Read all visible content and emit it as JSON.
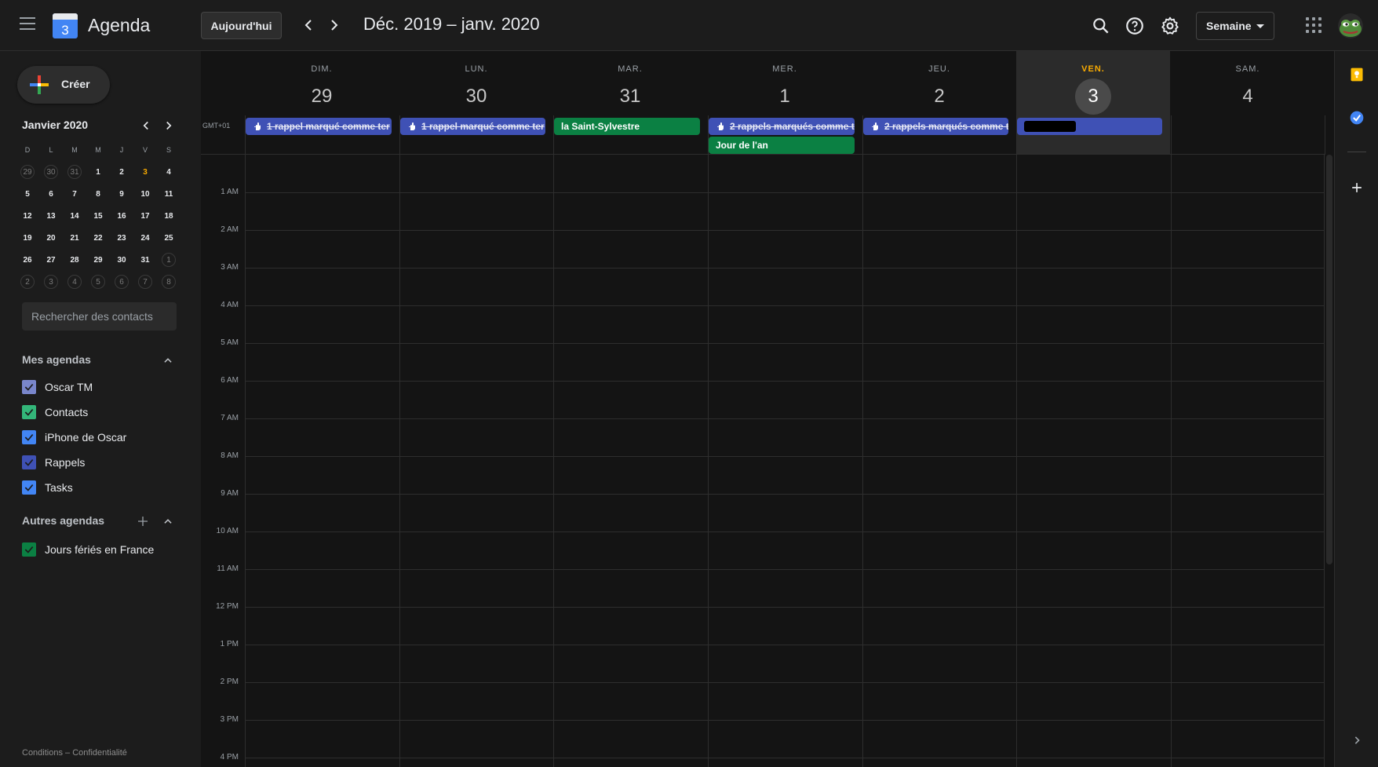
{
  "header": {
    "app_title": "Agenda",
    "logo_day": "3",
    "today_button": "Aujourd'hui",
    "date_range": "Déc. 2019 – janv. 2020",
    "view_selector": "Semaine"
  },
  "sidebar": {
    "create_label": "Créer",
    "mini_month": "Janvier 2020",
    "weekday_initials": [
      "D",
      "L",
      "M",
      "M",
      "J",
      "V",
      "S"
    ],
    "weeks": [
      [
        "29",
        "30",
        "31",
        "1",
        "2",
        "3",
        "4"
      ],
      [
        "5",
        "6",
        "7",
        "8",
        "9",
        "10",
        "11"
      ],
      [
        "12",
        "13",
        "14",
        "15",
        "16",
        "17",
        "18"
      ],
      [
        "19",
        "20",
        "21",
        "22",
        "23",
        "24",
        "25"
      ],
      [
        "26",
        "27",
        "28",
        "29",
        "30",
        "31",
        "1"
      ],
      [
        "2",
        "3",
        "4",
        "5",
        "6",
        "7",
        "8"
      ]
    ],
    "search_placeholder": "Rechercher des contacts",
    "my_calendars_title": "Mes agendas",
    "my_calendars": [
      {
        "label": "Oscar TM",
        "color": "#7986cb"
      },
      {
        "label": "Contacts",
        "color": "#33b679"
      },
      {
        "label": "iPhone de Oscar",
        "color": "#4285f4"
      },
      {
        "label": "Rappels",
        "color": "#3f51b5"
      },
      {
        "label": "Tasks",
        "color": "#4285f4"
      }
    ],
    "other_calendars_title": "Autres agendas",
    "other_calendars": [
      {
        "label": "Jours fériés en France",
        "color": "#0b8043"
      }
    ],
    "footer": "Conditions – Confidentialité"
  },
  "week": {
    "timezone": "GMT+01",
    "days": [
      {
        "name": "DIM.",
        "num": "29"
      },
      {
        "name": "LUN.",
        "num": "30"
      },
      {
        "name": "MAR.",
        "num": "31"
      },
      {
        "name": "MER.",
        "num": "1"
      },
      {
        "name": "JEU.",
        "num": "2"
      },
      {
        "name": "VEN.",
        "num": "3"
      },
      {
        "name": "SAM.",
        "num": "4"
      }
    ],
    "allday_events": {
      "sun_reminder": "1 rappel marqué comme ter",
      "mon_reminder": "1 rappel marqué comme ter",
      "tue_holiday": "la Saint-Sylvestre",
      "wed_reminder": "2 rappels marqués comme t",
      "wed_holiday": "Jour de l'an",
      "thu_reminder": "2 rappels marqués comme t"
    },
    "hours": [
      "1 AM",
      "2 AM",
      "3 AM",
      "4 AM",
      "5 AM",
      "6 AM",
      "7 AM",
      "8 AM",
      "9 AM",
      "10 AM",
      "11 AM",
      "12 PM",
      "1 PM",
      "2 PM",
      "3 PM",
      "4 PM"
    ]
  },
  "colors": {
    "reminder": "#3f51b5",
    "holiday": "#0b8043",
    "today_accent": "#f9ab00"
  }
}
